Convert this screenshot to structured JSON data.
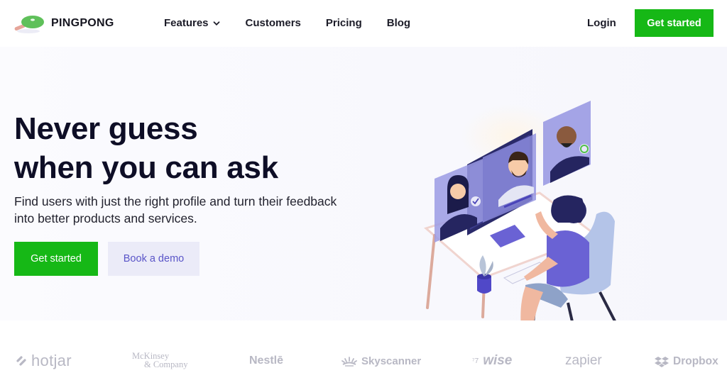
{
  "header": {
    "brand": "PINGPONG",
    "nav": [
      {
        "label": "Features",
        "has_dropdown": true
      },
      {
        "label": "Customers"
      },
      {
        "label": "Pricing"
      },
      {
        "label": "Blog"
      }
    ],
    "login_label": "Login",
    "cta_label": "Get started"
  },
  "hero": {
    "headline_line1": "Never guess",
    "headline_line2": "when you can ask",
    "subtext": "Find users with just the right profile and turn their feedback into better products and services.",
    "primary_cta": "Get started",
    "secondary_cta": "Book a demo"
  },
  "logos": {
    "hotjar": "hotjar",
    "mckinsey_line1": "McKinsey",
    "mckinsey_line2": "& Company",
    "nestle": "Nestlē",
    "skyscanner": "Skyscanner",
    "wise_prefix": "⁷7",
    "wise": "wise",
    "zapier": "zapier",
    "dropbox": "Dropbox"
  },
  "colors": {
    "accent_green": "#16b816",
    "demo_bg": "#ebebf8",
    "demo_text": "#5a55c8",
    "headline": "#0e0e26",
    "logo_gray": "#b8b8c4"
  }
}
